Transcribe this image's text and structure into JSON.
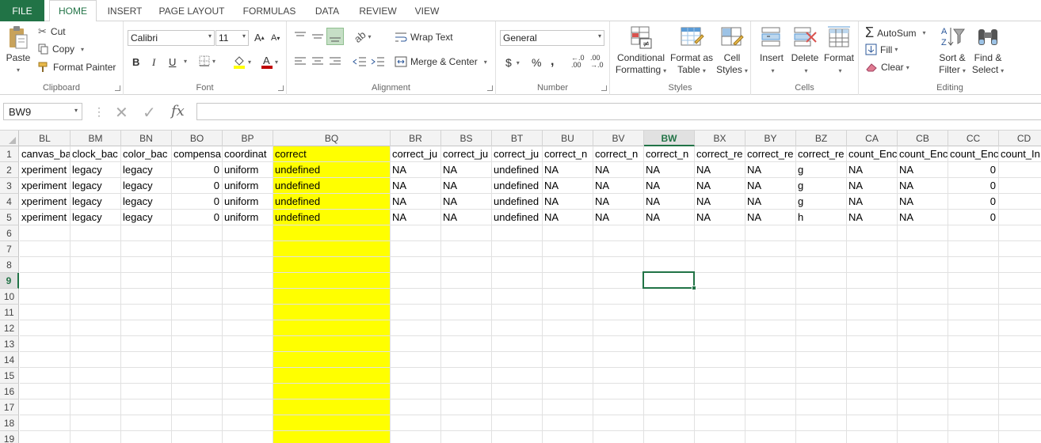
{
  "tabs": {
    "file": "FILE",
    "items": [
      "HOME",
      "INSERT",
      "PAGE LAYOUT",
      "FORMULAS",
      "DATA",
      "REVIEW",
      "VIEW"
    ]
  },
  "ribbon": {
    "clipboard": {
      "label": "Clipboard",
      "paste": "Paste",
      "cut": "Cut",
      "copy": "Copy",
      "format_painter": "Format Painter"
    },
    "font": {
      "label": "Font",
      "name": "Calibri",
      "size": "11",
      "bold": "B",
      "italic": "I",
      "underline": "U",
      "grow": "A",
      "shrink": "A"
    },
    "alignment": {
      "label": "Alignment",
      "wrap_text": "Wrap Text",
      "merge_center": "Merge & Center"
    },
    "number": {
      "label": "Number",
      "format": "General",
      "currency": "$",
      "percent": "%",
      "comma": ",",
      "inc_decimal": "←.0\n.00",
      "dec_decimal": ".00\n→.0"
    },
    "styles": {
      "label": "Styles",
      "conditional": [
        "Conditional",
        "Formatting"
      ],
      "format_table": [
        "Format as",
        "Table"
      ],
      "cell_styles": [
        "Cell",
        "Styles"
      ]
    },
    "cells": {
      "label": "Cells",
      "insert": "Insert",
      "delete": "Delete",
      "format": "Format"
    },
    "editing": {
      "label": "Editing",
      "autosum": "AutoSum",
      "fill": "Fill",
      "clear": "Clear",
      "sort_filter": [
        "Sort &",
        "Filter"
      ],
      "find_select": [
        "Find &",
        "Select"
      ]
    }
  },
  "formula_bar": {
    "name_box": "BW9",
    "formula": ""
  },
  "accent": "#217346",
  "highlight_color": "#ffff00",
  "selected_cell": {
    "col": "BW",
    "row": "9"
  },
  "columns": [
    "BL",
    "BM",
    "BN",
    "BO",
    "BP",
    "BQ",
    "BR",
    "BS",
    "BT",
    "BU",
    "BV",
    "BW",
    "BX",
    "BY",
    "BZ",
    "CA",
    "CB",
    "CC",
    "CD"
  ],
  "rows": [
    "1",
    "2",
    "3",
    "4",
    "5",
    "6",
    "7",
    "8",
    "9",
    "10",
    "11",
    "12",
    "13",
    "14",
    "15",
    "16",
    "17",
    "18",
    "19"
  ],
  "sheet": [
    [
      "canvas_ba",
      "clock_bac",
      "color_bac",
      "compensa",
      "coordinat",
      "correct",
      "correct_ju",
      "correct_ju",
      "correct_ju",
      "correct_n",
      "correct_n",
      "correct_n",
      "correct_re",
      "correct_re",
      "correct_re",
      "count_Enc",
      "count_Enc",
      "count_Enc",
      "count_In"
    ],
    [
      "xperiment",
      "legacy",
      "legacy",
      "0",
      "uniform",
      "undefined",
      "NA",
      "NA",
      "undefined",
      "NA",
      "NA",
      "NA",
      "NA",
      "NA",
      "g",
      "NA",
      "NA",
      "0",
      ""
    ],
    [
      "xperiment",
      "legacy",
      "legacy",
      "0",
      "uniform",
      "undefined",
      "NA",
      "NA",
      "undefined",
      "NA",
      "NA",
      "NA",
      "NA",
      "NA",
      "g",
      "NA",
      "NA",
      "0",
      ""
    ],
    [
      "xperiment",
      "legacy",
      "legacy",
      "0",
      "uniform",
      "undefined",
      "NA",
      "NA",
      "undefined",
      "NA",
      "NA",
      "NA",
      "NA",
      "NA",
      "g",
      "NA",
      "NA",
      "0",
      ""
    ],
    [
      "xperiment",
      "legacy",
      "legacy",
      "0",
      "uniform",
      "undefined",
      "NA",
      "NA",
      "undefined",
      "NA",
      "NA",
      "NA",
      "NA",
      "NA",
      "h",
      "NA",
      "NA",
      "0",
      ""
    ]
  ]
}
